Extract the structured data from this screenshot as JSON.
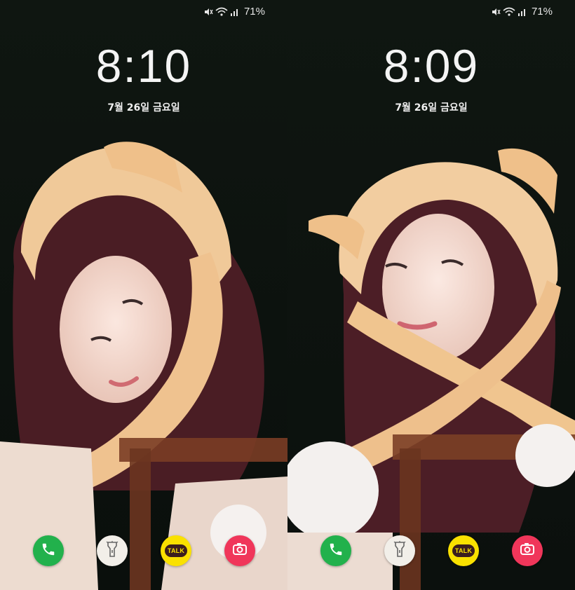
{
  "screens": [
    {
      "status": {
        "battery_pct": "71%",
        "icons": [
          "mute-icon",
          "wifi-icon",
          "signal-icon"
        ]
      },
      "clock": {
        "time": "8:10",
        "date": "7월 26일 금요일"
      },
      "dock": {
        "apps": [
          {
            "icon": "phone-icon",
            "color": "#22b14c"
          },
          {
            "icon": "flashlight-icon",
            "color": "#f2efe9"
          },
          {
            "icon": "kakaotalk-icon",
            "label": "TALK",
            "color": "#fae100"
          },
          {
            "icon": "camera-icon",
            "color": "#f0365a"
          }
        ]
      }
    },
    {
      "status": {
        "battery_pct": "71%",
        "icons": [
          "mute-icon",
          "wifi-icon",
          "signal-icon"
        ]
      },
      "clock": {
        "time": "8:09",
        "date": "7월 26일 금요일"
      },
      "dock": {
        "apps": [
          {
            "icon": "phone-icon",
            "color": "#22b14c"
          },
          {
            "icon": "flashlight-icon",
            "color": "#f2efe9"
          },
          {
            "icon": "kakaotalk-icon",
            "label": "TALK",
            "color": "#fae100"
          },
          {
            "icon": "camera-icon",
            "color": "#f0365a"
          }
        ]
      }
    }
  ]
}
